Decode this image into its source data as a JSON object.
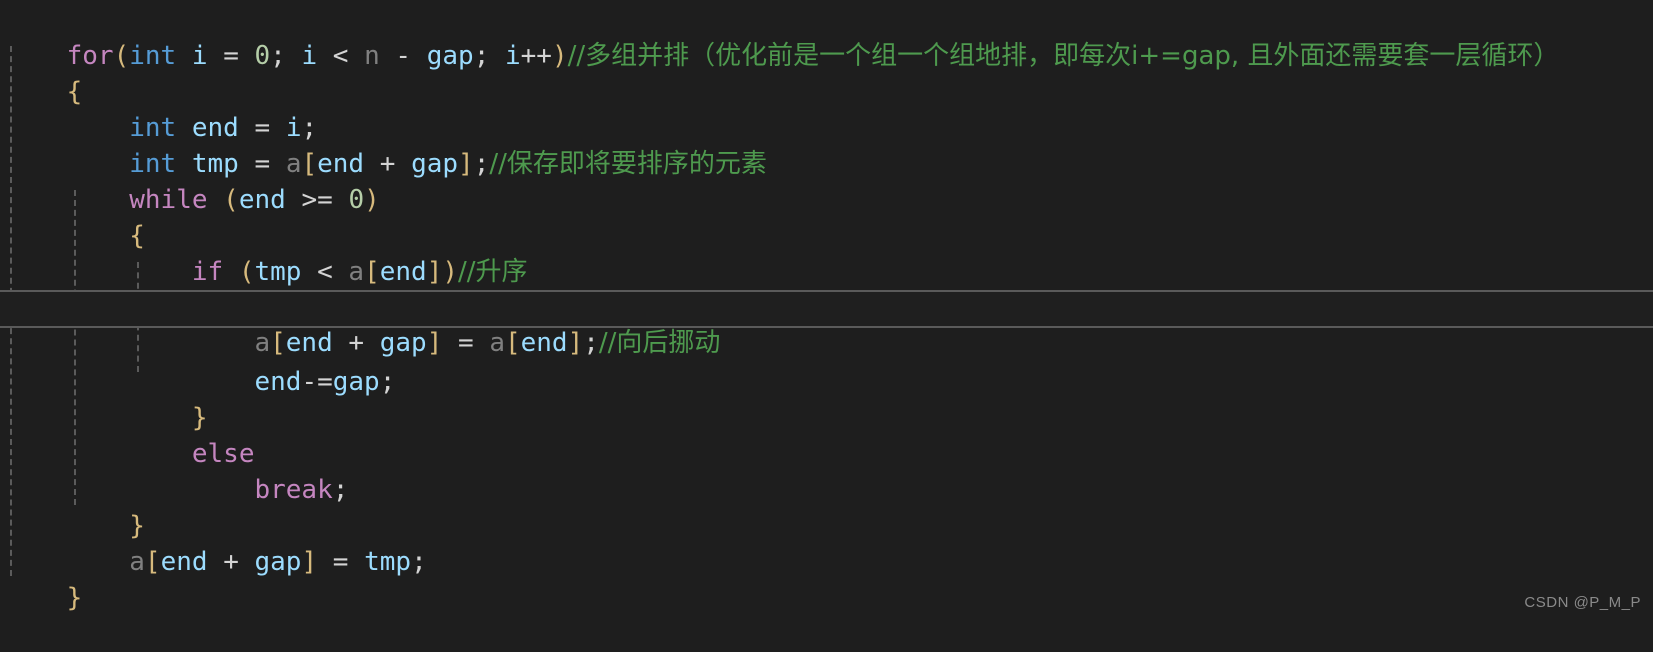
{
  "editor": {
    "background_color": "#1e1e1e",
    "default_text_color": "#d4d4d4",
    "current_line_border_color": "#5a5a5a",
    "indent_guide_color": "#707070",
    "colors": {
      "keyword": "#c586c0",
      "type": "#569cd6",
      "variable": "#9cdcfe",
      "dimmed": "#808080",
      "number": "#b5cea8",
      "operator": "#d4d4d4",
      "bracket": "#d7ba7d",
      "comment": "#4e9a4e"
    },
    "language": "C"
  },
  "code": {
    "line_01": {
      "kw_for": "for",
      "paren_open": "(",
      "type_int": "int",
      "var_i": " i ",
      "eq": "= ",
      "num_0": "0",
      "semi1": "; ",
      "var_i2": "i ",
      "lt": "< ",
      "var_n": "n ",
      "minus": "- ",
      "var_gap": "gap",
      "semi2": "; ",
      "var_i3": "i",
      "incr": "++",
      "paren_close": ")",
      "comment": "//多组并排（优化前是一个组一个组地排，即每次i+=gap, 且外面还需要套一层循环）"
    },
    "line_02": {
      "brace": "{"
    },
    "line_03": {
      "indent": "    ",
      "type_int": "int",
      "var_end": " end ",
      "eq": "= ",
      "var_i": "i",
      "semi": ";"
    },
    "line_04": {
      "indent": "    ",
      "type_int": "int",
      "var_tmp": " tmp ",
      "eq": "= ",
      "var_a": "a",
      "lbr": "[",
      "var_end": "end ",
      "plus": "+ ",
      "var_gap": "gap",
      "rbr": "]",
      "semi": ";",
      "comment": "//保存即将要排序的元素"
    },
    "line_05": {
      "indent": "    ",
      "kw_while": "while",
      "paren_open": " (",
      "var_end": "end ",
      "ge": ">= ",
      "num_0": "0",
      "paren_close": ")"
    },
    "line_06": {
      "indent": "    ",
      "brace": "{"
    },
    "line_07": {
      "indent": "        ",
      "kw_if": "if",
      "paren_open": " (",
      "var_tmp": "tmp ",
      "lt": "< ",
      "var_a": "a",
      "lbr": "[",
      "var_end": "end",
      "rbr": "]",
      "paren_close": ")",
      "comment": "//升序"
    },
    "line_08": {
      "indent": "        ",
      "brace": "{"
    },
    "line_09": {
      "indent": "            ",
      "var_a": "a",
      "lbr": "[",
      "var_end": "end ",
      "plus": "+ ",
      "var_gap": "gap",
      "rbr": "]",
      "eq": " = ",
      "var_a2": "a",
      "lbr2": "[",
      "var_end2": "end",
      "rbr2": "]",
      "semi": ";",
      "comment": "//向后挪动",
      "is_current_line": true
    },
    "line_10": {
      "indent": "            ",
      "var_end": "end",
      "minuseq": "-=",
      "var_gap": "gap",
      "semi": ";"
    },
    "line_11": {
      "indent": "        ",
      "brace": "}"
    },
    "line_12": {
      "indent": "        ",
      "kw_else": "else"
    },
    "line_13": {
      "indent": "            ",
      "kw_break": "break",
      "semi": ";"
    },
    "line_14": {
      "indent": "    ",
      "brace": "}"
    },
    "line_15": {
      "indent": "    ",
      "var_a": "a",
      "lbr": "[",
      "var_end": "end ",
      "plus": "+ ",
      "var_gap": "gap",
      "rbr": "]",
      "eq": " = ",
      "var_tmp": "tmp",
      "semi": ";"
    },
    "line_16": {
      "brace": "}"
    }
  },
  "watermark": {
    "text": "CSDN @P_M_P"
  }
}
